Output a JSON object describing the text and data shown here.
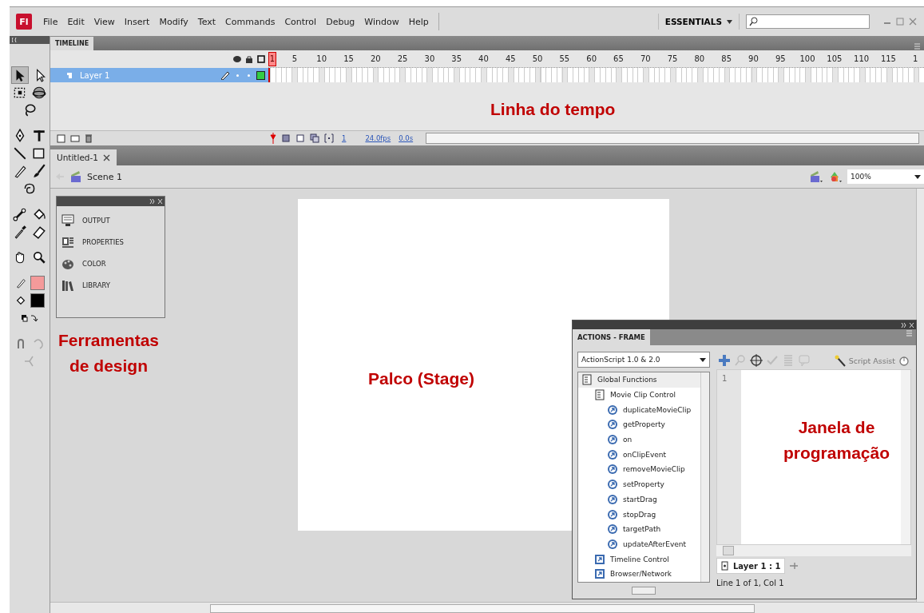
{
  "app_icon": "Fl",
  "menu": [
    "File",
    "Edit",
    "View",
    "Insert",
    "Modify",
    "Text",
    "Commands",
    "Control",
    "Debug",
    "Window",
    "Help"
  ],
  "workspace": "ESSENTIALS",
  "timeline": {
    "tab": "TIMELINE",
    "frame_numbers": [
      "1",
      "5",
      "10",
      "15",
      "20",
      "25",
      "30",
      "35",
      "40",
      "45",
      "50",
      "55",
      "60",
      "65",
      "70",
      "75",
      "80",
      "85",
      "90",
      "95",
      "100",
      "105",
      "110",
      "115",
      "1"
    ],
    "layers": [
      {
        "name": "Layer 1",
        "selected": true
      }
    ],
    "current_frame": "1",
    "fps": "24.0fps",
    "time": "0.0s"
  },
  "document_tabs": [
    {
      "label": "Untitled-1",
      "selected": true
    }
  ],
  "scene": "Scene 1",
  "zoom": "100%",
  "panel_group": {
    "items": [
      "OUTPUT",
      "PROPERTIES",
      "COLOR",
      "LIBRARY"
    ]
  },
  "actions_panel": {
    "title": "ACTIONS - FRAME",
    "language": "ActionScript 1.0 & 2.0",
    "script_assist": "Script Assist",
    "tree": [
      {
        "label": "Global Functions",
        "kind": "book",
        "selected": true,
        "children": [
          {
            "label": "Movie Clip Control",
            "kind": "book",
            "selected": false,
            "children": [
              {
                "label": "duplicateMovieClip",
                "kind": "function",
                "selected": false
              },
              {
                "label": "getProperty",
                "kind": "function",
                "selected": false
              },
              {
                "label": "on",
                "kind": "function",
                "selected": false
              },
              {
                "label": "onClipEvent",
                "kind": "function",
                "selected": false
              },
              {
                "label": "removeMovieClip",
                "kind": "function",
                "selected": false
              },
              {
                "label": "setProperty",
                "kind": "function",
                "selected": false
              },
              {
                "label": "startDrag",
                "kind": "function",
                "selected": false
              },
              {
                "label": "stopDrag",
                "kind": "function",
                "selected": false
              },
              {
                "label": "targetPath",
                "kind": "function",
                "selected": false
              },
              {
                "label": "updateAfterEvent",
                "kind": "function",
                "selected": false
              }
            ]
          },
          {
            "label": "Timeline Control",
            "kind": "category",
            "selected": false
          },
          {
            "label": "Browser/Network",
            "kind": "category",
            "selected": false
          }
        ]
      }
    ],
    "line_numbers": [
      "1"
    ],
    "layer_tab": "Layer 1 : 1",
    "status": "Line 1 of 1, Col 1"
  },
  "annotations": [
    "Linha do tempo",
    "Ferramentas de design",
    "Palco (Stage)",
    "Janela de programação"
  ]
}
